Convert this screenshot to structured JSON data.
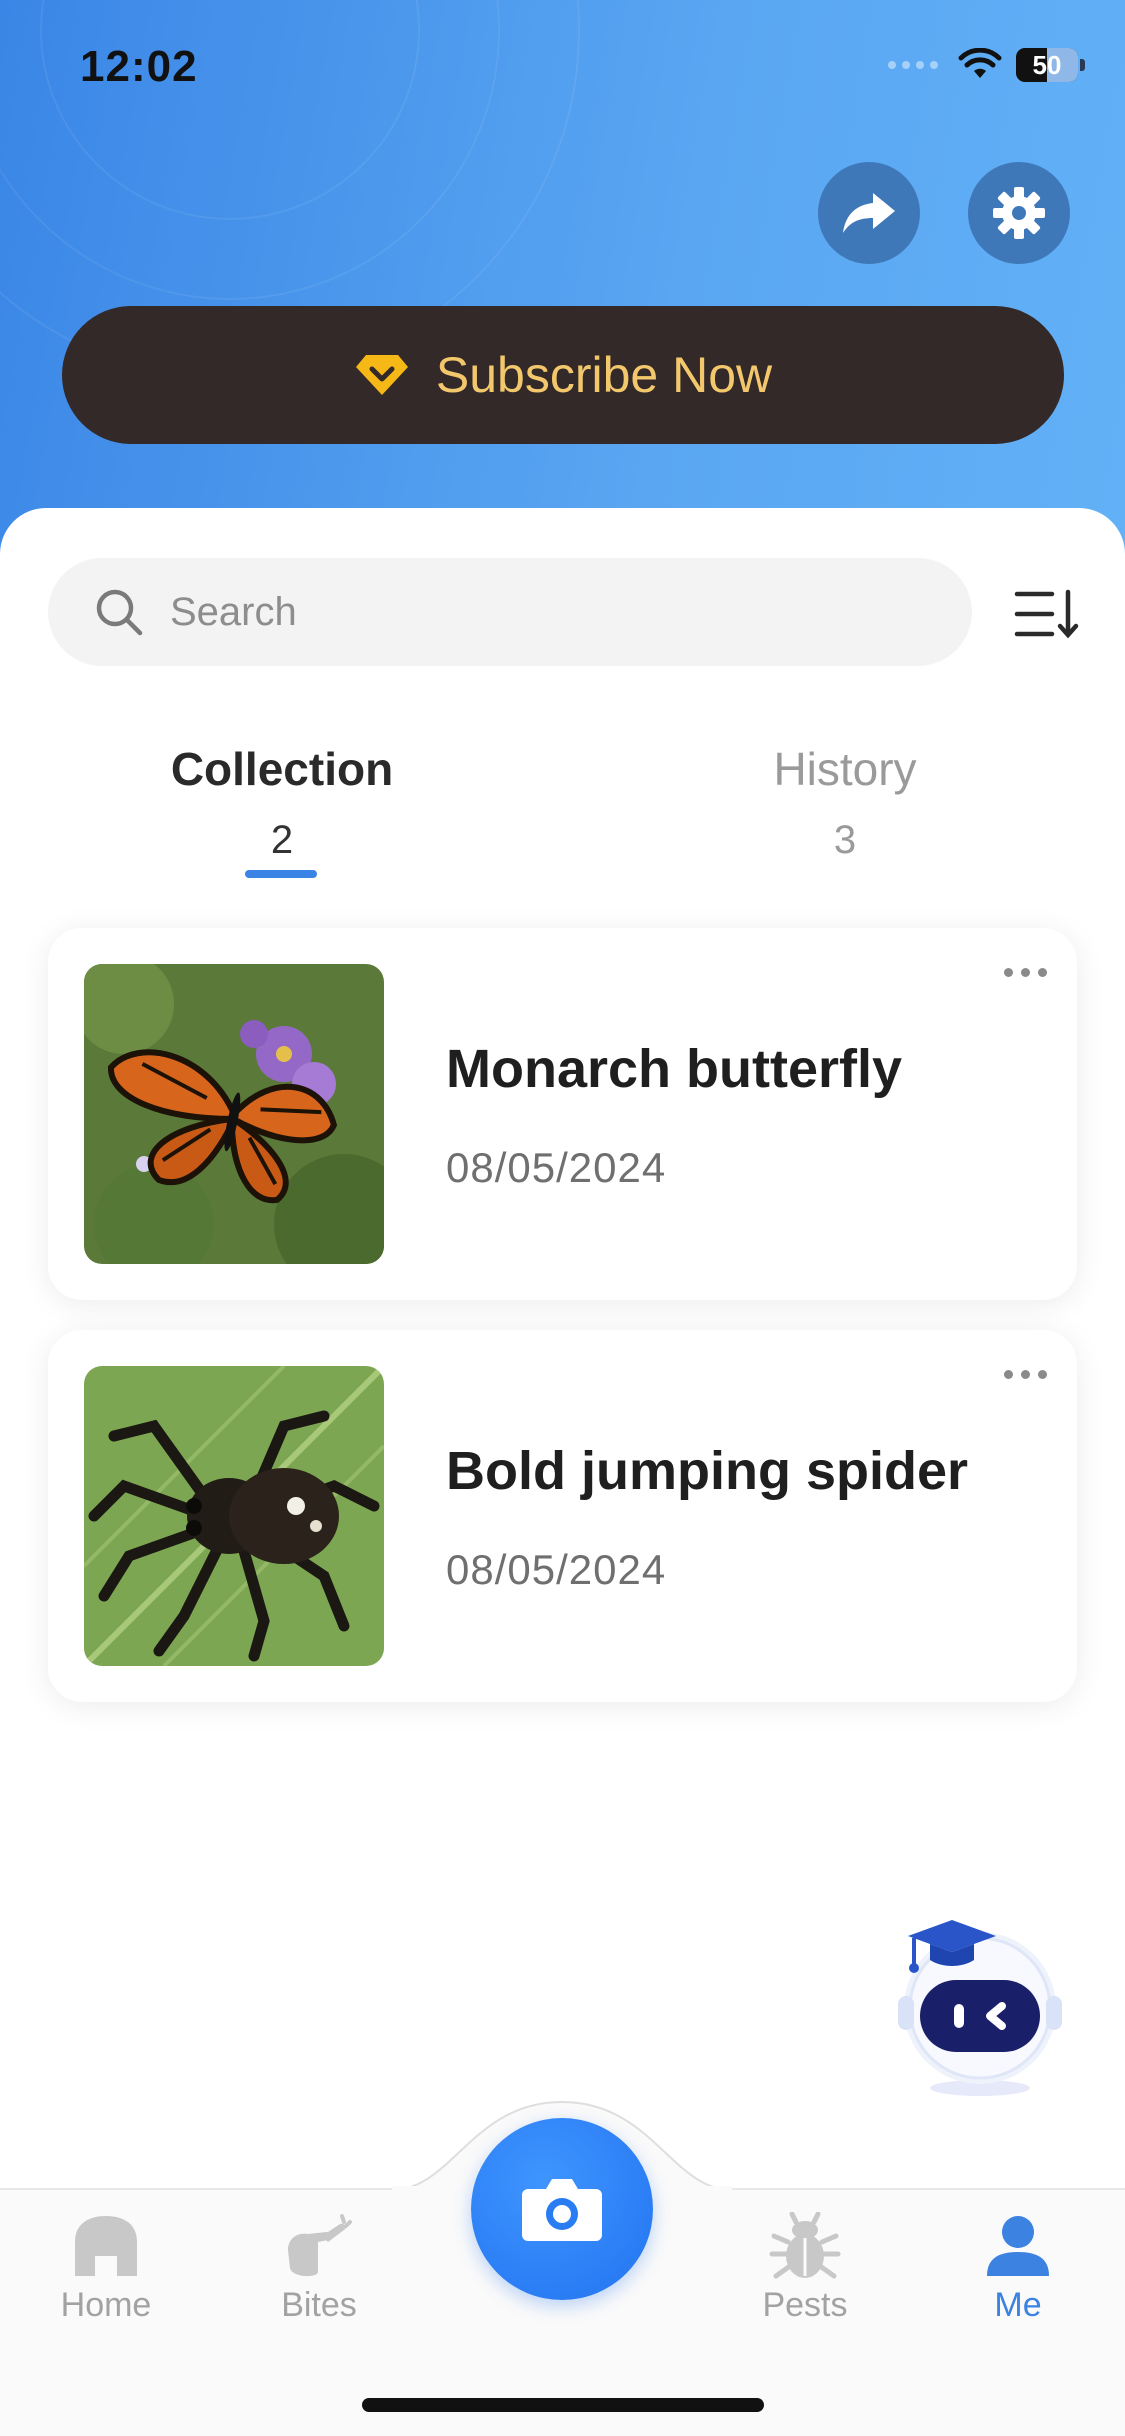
{
  "status_bar": {
    "time": "12:02",
    "battery": "50"
  },
  "header": {
    "subscribe_label": "Subscribe Now",
    "share_icon": "share-arrow-icon",
    "settings_icon": "gear-icon"
  },
  "search": {
    "placeholder": "Search"
  },
  "tabs": [
    {
      "label": "Collection",
      "count": "2",
      "selected": true
    },
    {
      "label": "History",
      "count": "3",
      "selected": false
    }
  ],
  "collection": [
    {
      "name": "Monarch butterfly",
      "date": "08/05/2024",
      "image": "monarch-butterfly-photo"
    },
    {
      "name": "Bold jumping spider",
      "date": "08/05/2024",
      "image": "jumping-spider-photo"
    }
  ],
  "tab_bar": {
    "items": [
      {
        "label": "Home",
        "icon": "home-icon"
      },
      {
        "label": "Bites",
        "icon": "bites-hand-icon"
      },
      {
        "label": "Pests",
        "icon": "bug-icon"
      },
      {
        "label": "Me",
        "icon": "person-icon",
        "active": true
      }
    ],
    "center_icon": "camera-icon"
  },
  "colors": {
    "header_gradient_start": "#3a86e6",
    "header_gradient_end": "#62b1f7",
    "subscribe_bg": "#322928",
    "subscribe_text": "#f3c86c",
    "accent": "#3b83e4",
    "camera_button": "#2273ef"
  }
}
